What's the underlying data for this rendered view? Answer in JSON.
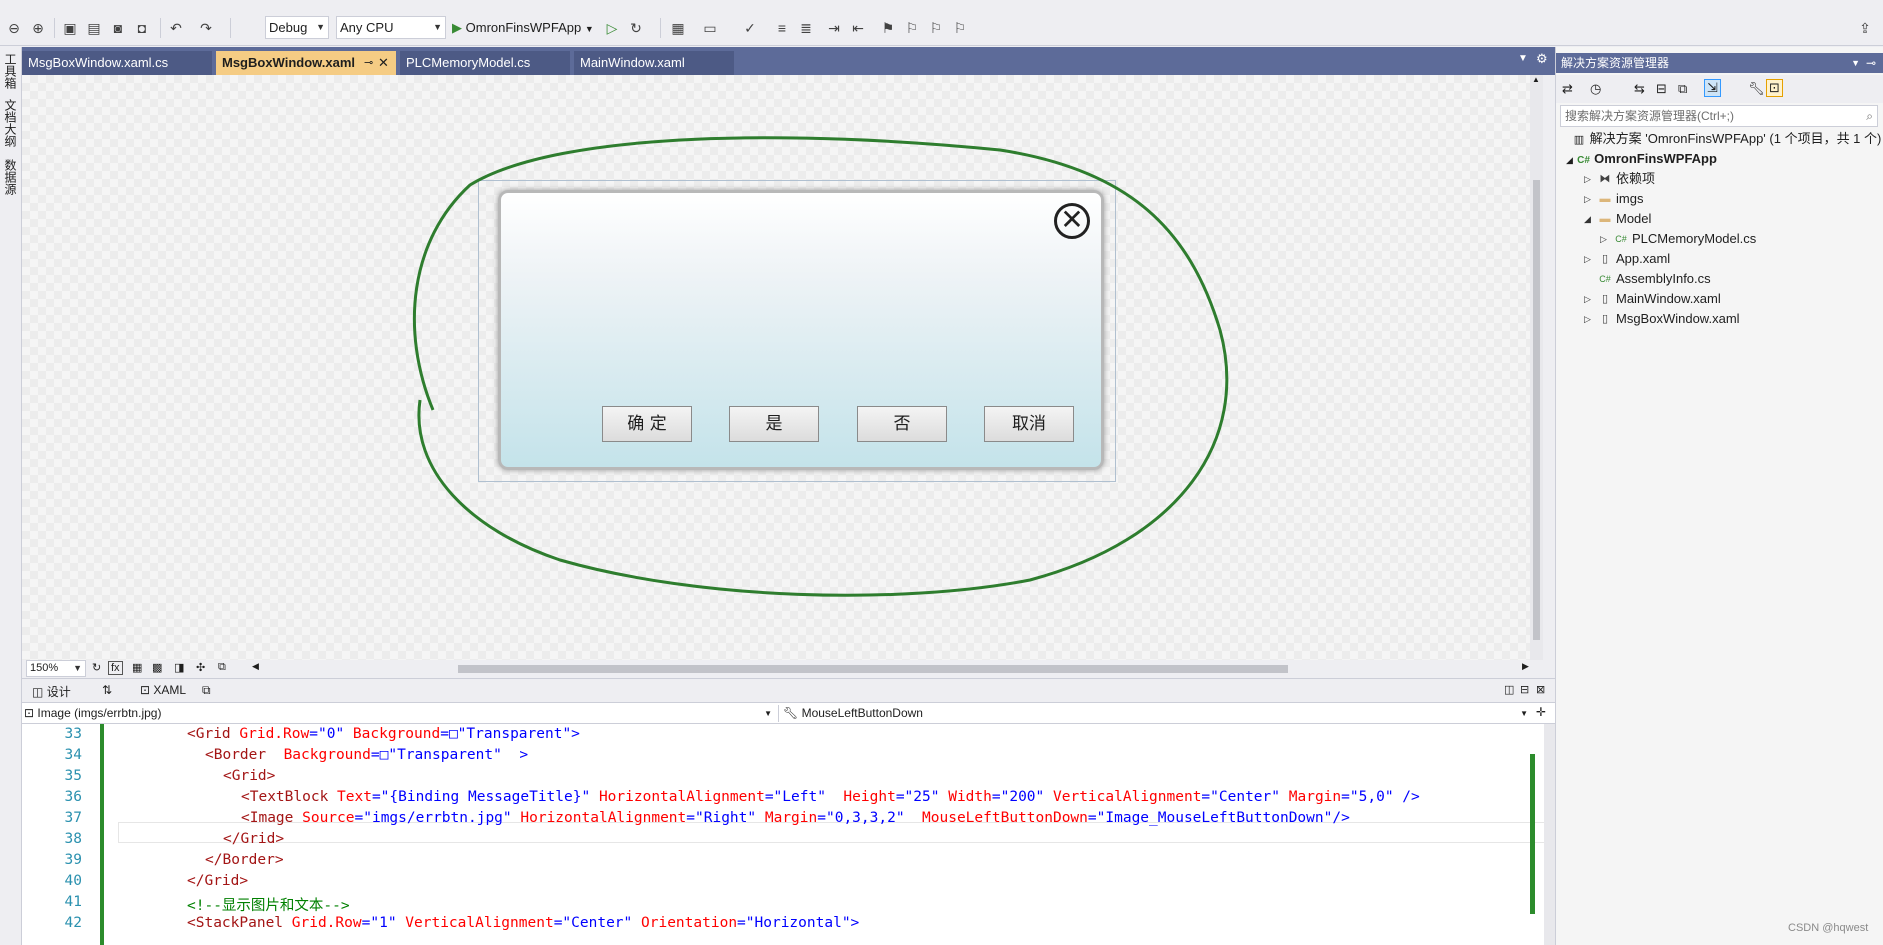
{
  "toolbar": {
    "config": "Debug",
    "platform": "Any CPU",
    "start_target": "OmronFinsWPFApp"
  },
  "left_dock": [
    "工具箱",
    "文档大纲",
    "数据源"
  ],
  "doc_tabs": [
    {
      "label": "MsgBoxWindow.xaml.cs",
      "active": false
    },
    {
      "label": "MsgBoxWindow.xaml",
      "active": true
    },
    {
      "label": "PLCMemoryModel.cs",
      "active": false
    },
    {
      "label": "MainWindow.xaml",
      "active": false
    }
  ],
  "designer": {
    "zoom": "150%",
    "dialog_buttons": [
      "确 定",
      "是",
      "否",
      "取消"
    ],
    "close_glyph": "✕"
  },
  "view_tabs": {
    "design": "设计",
    "swap": "⇅",
    "xaml": "XAML"
  },
  "nav": {
    "element": "Image (imgs/errbtn.jpg)",
    "event": "MouseLeftButtonDown"
  },
  "code_lines": [
    {
      "num": "33",
      "indent": 0,
      "html_parts": [
        [
          "t",
          "<Grid "
        ],
        [
          "a",
          "Grid.Row"
        ],
        [
          "d",
          "=\""
        ],
        [
          "v",
          "0"
        ],
        [
          "d",
          "\" "
        ],
        [
          "a",
          "Background"
        ],
        [
          "d",
          "=□\""
        ],
        [
          "v",
          "Transparent"
        ],
        [
          "d",
          "\">"
        ]
      ]
    },
    {
      "num": "34",
      "indent": 1,
      "html_parts": [
        [
          "t",
          "<Border  "
        ],
        [
          "a",
          "Background"
        ],
        [
          "d",
          "=□\""
        ],
        [
          "v",
          "Transparent"
        ],
        [
          "d",
          "\"  >"
        ]
      ]
    },
    {
      "num": "35",
      "indent": 2,
      "html_parts": [
        [
          "t",
          "<Grid>"
        ]
      ]
    },
    {
      "num": "36",
      "indent": 3,
      "html_parts": [
        [
          "t",
          "<TextBlock "
        ],
        [
          "a",
          "Text"
        ],
        [
          "d",
          "=\""
        ],
        [
          "v",
          "{Binding MessageTitle}"
        ],
        [
          "d",
          "\" "
        ],
        [
          "a",
          "HorizontalAlignment"
        ],
        [
          "d",
          "=\""
        ],
        [
          "v",
          "Left"
        ],
        [
          "d",
          "\"  "
        ],
        [
          "a",
          "Height"
        ],
        [
          "d",
          "=\""
        ],
        [
          "v",
          "25"
        ],
        [
          "d",
          "\" "
        ],
        [
          "a",
          "Width"
        ],
        [
          "d",
          "=\""
        ],
        [
          "v",
          "200"
        ],
        [
          "d",
          "\" "
        ],
        [
          "a",
          "VerticalAlignment"
        ],
        [
          "d",
          "=\""
        ],
        [
          "v",
          "Center"
        ],
        [
          "d",
          "\" "
        ],
        [
          "a",
          "Margin"
        ],
        [
          "d",
          "=\""
        ],
        [
          "v",
          "5,0"
        ],
        [
          "d",
          "\" />"
        ]
      ]
    },
    {
      "num": "37",
      "indent": 3,
      "html_parts": [
        [
          "t",
          "<Image "
        ],
        [
          "a",
          "Source"
        ],
        [
          "d",
          "=\""
        ],
        [
          "v",
          "imgs/errbtn.jpg"
        ],
        [
          "d",
          "\" "
        ],
        [
          "a",
          "HorizontalAlignment"
        ],
        [
          "d",
          "=\""
        ],
        [
          "v",
          "Right"
        ],
        [
          "d",
          "\" "
        ],
        [
          "a",
          "Margin"
        ],
        [
          "d",
          "=\""
        ],
        [
          "v",
          "0,3,3,2"
        ],
        [
          "d",
          "\"  "
        ],
        [
          "a",
          "MouseLeftButtonDown"
        ],
        [
          "d",
          "=\""
        ],
        [
          "v",
          "Image_MouseLeftButtonDown"
        ],
        [
          "d",
          "\"/>"
        ]
      ]
    },
    {
      "num": "38",
      "indent": 2,
      "html_parts": [
        [
          "t",
          "</Grid>"
        ]
      ]
    },
    {
      "num": "39",
      "indent": 1,
      "html_parts": [
        [
          "t",
          "</Border>"
        ]
      ]
    },
    {
      "num": "40",
      "indent": 0,
      "html_parts": [
        [
          "t",
          "</Grid>"
        ]
      ]
    },
    {
      "num": "41",
      "indent": 0,
      "html_parts": [
        [
          "c",
          "<!--显示图片和文本-->"
        ]
      ]
    },
    {
      "num": "42",
      "indent": 0,
      "html_parts": [
        [
          "t",
          "<StackPanel "
        ],
        [
          "a",
          "Grid.Row"
        ],
        [
          "d",
          "=\""
        ],
        [
          "v",
          "1"
        ],
        [
          "d",
          "\" "
        ],
        [
          "a",
          "VerticalAlignment"
        ],
        [
          "d",
          "=\""
        ],
        [
          "v",
          "Center"
        ],
        [
          "d",
          "\" "
        ],
        [
          "a",
          "Orientation"
        ],
        [
          "d",
          "=\""
        ],
        [
          "v",
          "Horizontal"
        ],
        [
          "d",
          "\">"
        ]
      ]
    }
  ],
  "solution_explorer": {
    "title": "解决方案资源管理器",
    "search_placeholder": "搜索解决方案资源管理器(Ctrl+;)",
    "solution_label": "解决方案 'OmronFinsWPFApp' (1 个项目，共 1 个)",
    "project": "OmronFinsWPFApp",
    "items": [
      {
        "label": "依赖项",
        "level": 2,
        "expander": "▷",
        "icon": "dependencies-icon"
      },
      {
        "label": "imgs",
        "level": 2,
        "expander": "▷",
        "icon": "folder-icon"
      },
      {
        "label": "Model",
        "level": 2,
        "expander": "◢",
        "icon": "folder-icon"
      },
      {
        "label": "PLCMemoryModel.cs",
        "level": 3,
        "expander": "▷",
        "icon": "csharp-file-icon"
      },
      {
        "label": "App.xaml",
        "level": 2,
        "expander": "▷",
        "icon": "xaml-file-icon"
      },
      {
        "label": "AssemblyInfo.cs",
        "level": 2,
        "expander": "",
        "icon": "csharp-file-icon"
      },
      {
        "label": "MainWindow.xaml",
        "level": 2,
        "expander": "▷",
        "icon": "xaml-file-icon"
      },
      {
        "label": "MsgBoxWindow.xaml",
        "level": 2,
        "expander": "▷",
        "icon": "xaml-file-icon"
      }
    ]
  },
  "watermark": "CSDN @hqwest",
  "colors": {
    "accent_tab": "#f5cc84",
    "frame": "#5d6b99",
    "annotation": "#2e7d2e"
  }
}
